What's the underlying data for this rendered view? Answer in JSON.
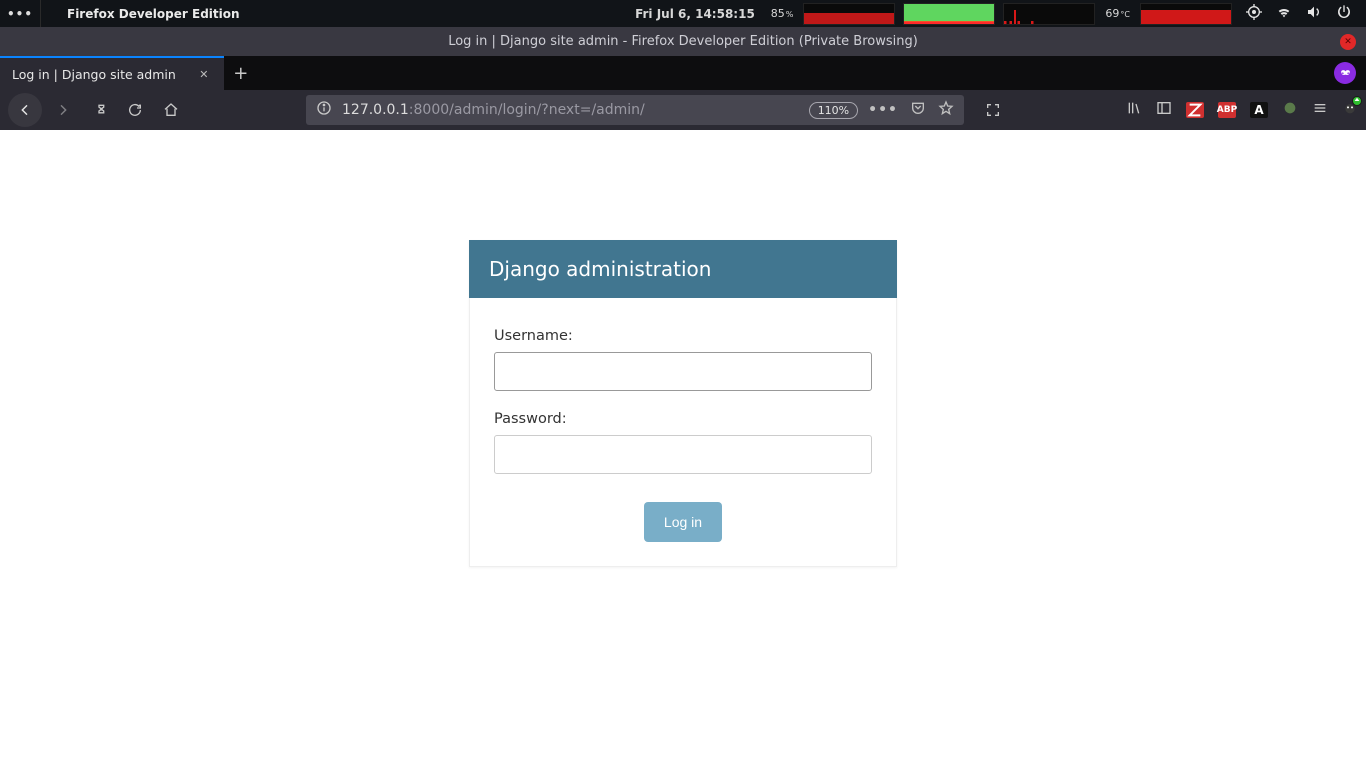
{
  "sysbar": {
    "app_title": "Firefox Developer Edition",
    "datetime": "Fri Jul  6, 14:58:15",
    "battery_pct": "85",
    "battery_unit": "%",
    "temp_val": "69",
    "temp_unit": "°C"
  },
  "window": {
    "title": "Log in | Django site admin - Firefox Developer Edition (Private Browsing)"
  },
  "tab": {
    "title": "Log in | Django site admin"
  },
  "url": {
    "host": "127.0.0.1",
    "rest": ":8000/admin/login/?next=/admin/",
    "zoom": "110%"
  },
  "ext": {
    "abp": "ABP",
    "A": "A"
  },
  "login": {
    "header": "Django administration",
    "username_label": "Username:",
    "password_label": "Password:",
    "username_value": "",
    "password_value": "",
    "submit_label": "Log in"
  }
}
